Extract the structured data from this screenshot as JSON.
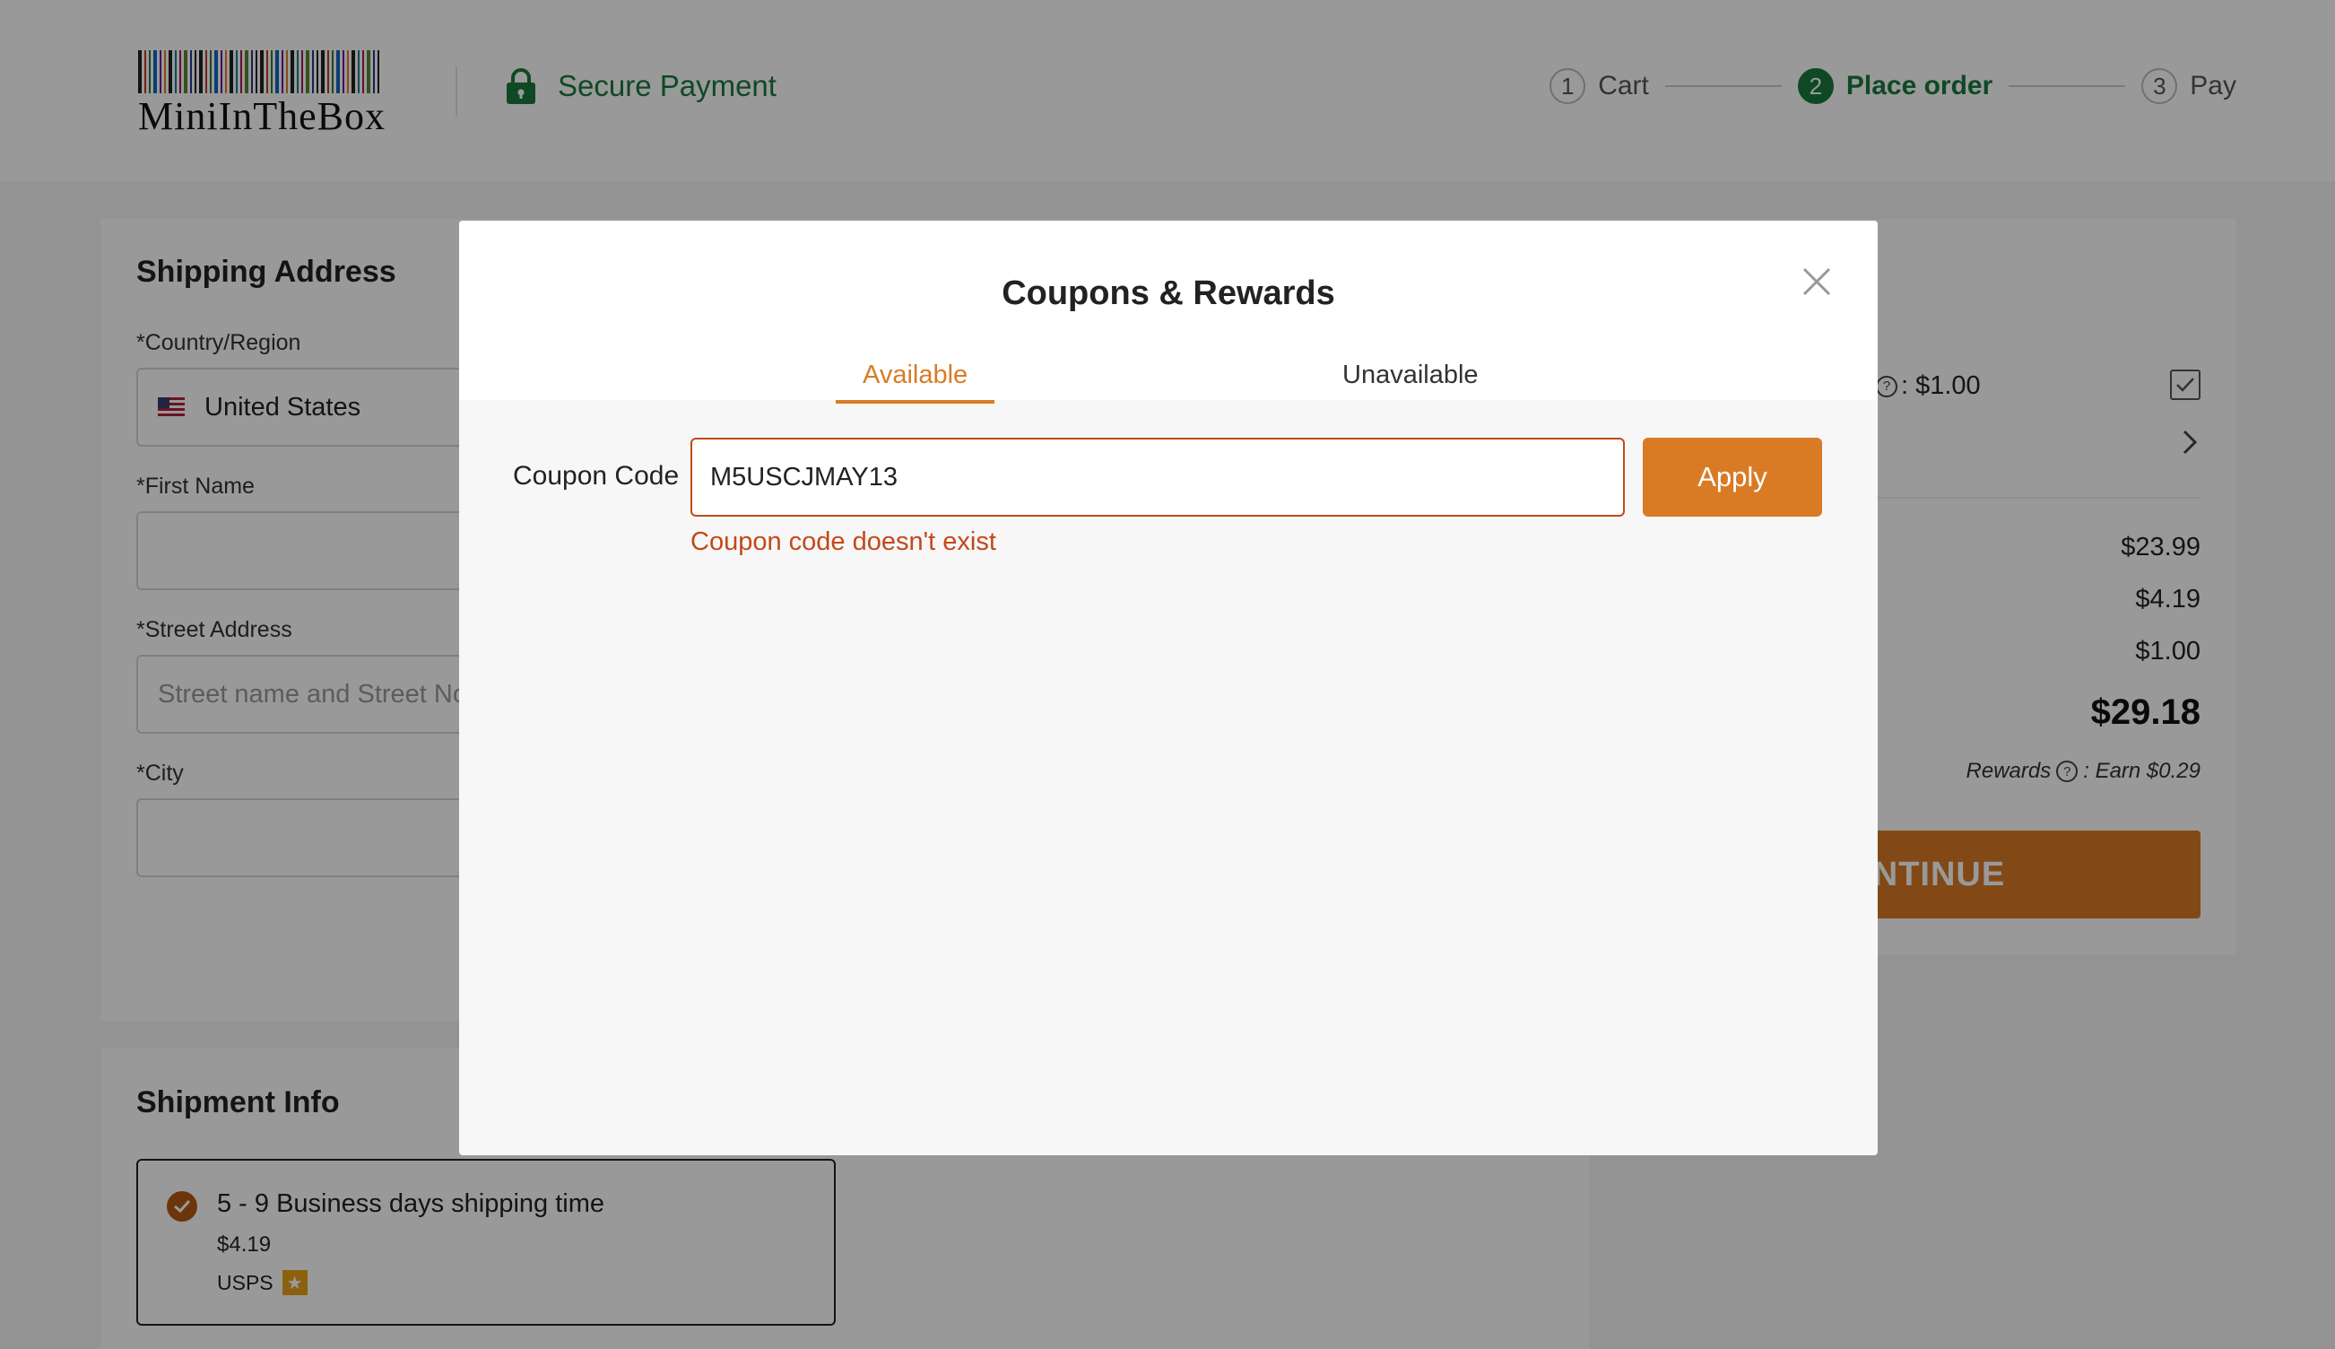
{
  "header": {
    "logo_text": "MiniInTheBox",
    "secure_label": "Secure Payment",
    "steps": [
      {
        "num": "1",
        "label": "Cart"
      },
      {
        "num": "2",
        "label": "Place order"
      },
      {
        "num": "3",
        "label": "Pay"
      }
    ],
    "active_step": 2,
    "colors": {
      "brand_green": "#1a7a3c",
      "accent_orange": "#d97b25",
      "error_red": "#c4481a"
    }
  },
  "shipping": {
    "title": "Shipping Address",
    "country_label": "*Country/Region",
    "country_value": "United States",
    "first_name_label": "*First Name",
    "first_name_value": "",
    "street_label": "*Street Address",
    "street_placeholder": "Street name and Street No.",
    "city_label": "*City",
    "city_value": ""
  },
  "shipment": {
    "title": "Shipment Info",
    "option_time": "5 - 9 Business days shipping time",
    "option_price": "$4.19",
    "option_carrier": "USPS"
  },
  "summary": {
    "reward_value": ": $1.00",
    "rows": [
      "$23.99",
      "$4.19",
      "$1.00"
    ],
    "total": "$29.18",
    "earn_prefix": "Rewards",
    "earn_value": ": Earn $0.29",
    "continue_label": "CONTINUE"
  },
  "modal": {
    "title": "Coupons & Rewards",
    "tabs": [
      {
        "label": "Available",
        "active": true
      },
      {
        "label": "Unavailable",
        "active": false
      }
    ],
    "coupon_label": "Coupon Code",
    "coupon_value": "M5USCJMAY13",
    "apply_label": "Apply",
    "error_text": "Coupon code doesn't exist"
  }
}
